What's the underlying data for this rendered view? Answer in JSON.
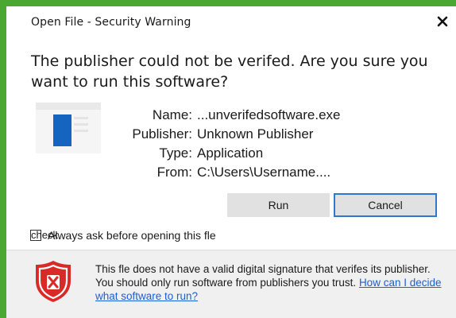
{
  "window": {
    "title": "Open File - Security Warning"
  },
  "heading": "The publisher could not be verifed. Are you sure you want to run this software?",
  "details": [
    {
      "key": "Name:",
      "value": "...unverifedsoftware.exe"
    },
    {
      "key": "Publisher:",
      "value": "Unknown Publisher"
    },
    {
      "key": "Type:",
      "value": "Application"
    },
    {
      "key": "From:",
      "value": "C:\\Users\\Username...."
    }
  ],
  "buttons": {
    "run": "Run",
    "cancel": "Cancel"
  },
  "checkbox": {
    "placeholder": "check",
    "label": "Always ask before opening this fle"
  },
  "footer": {
    "text": "This fle does not have a valid digital signature that verifes its publisher. You should only run software from publishers you trust. ",
    "link": "How can I decide what software to run?"
  },
  "colors": {
    "background": "#4aa832",
    "accent": "#2f78cf",
    "shield_red": "#d92a27",
    "app_icon_blue": "#1565c0",
    "link": "#1a5fd6"
  },
  "icons": {
    "close": "close-icon",
    "app": "application-file-icon",
    "warning": "shield-warning-icon"
  }
}
